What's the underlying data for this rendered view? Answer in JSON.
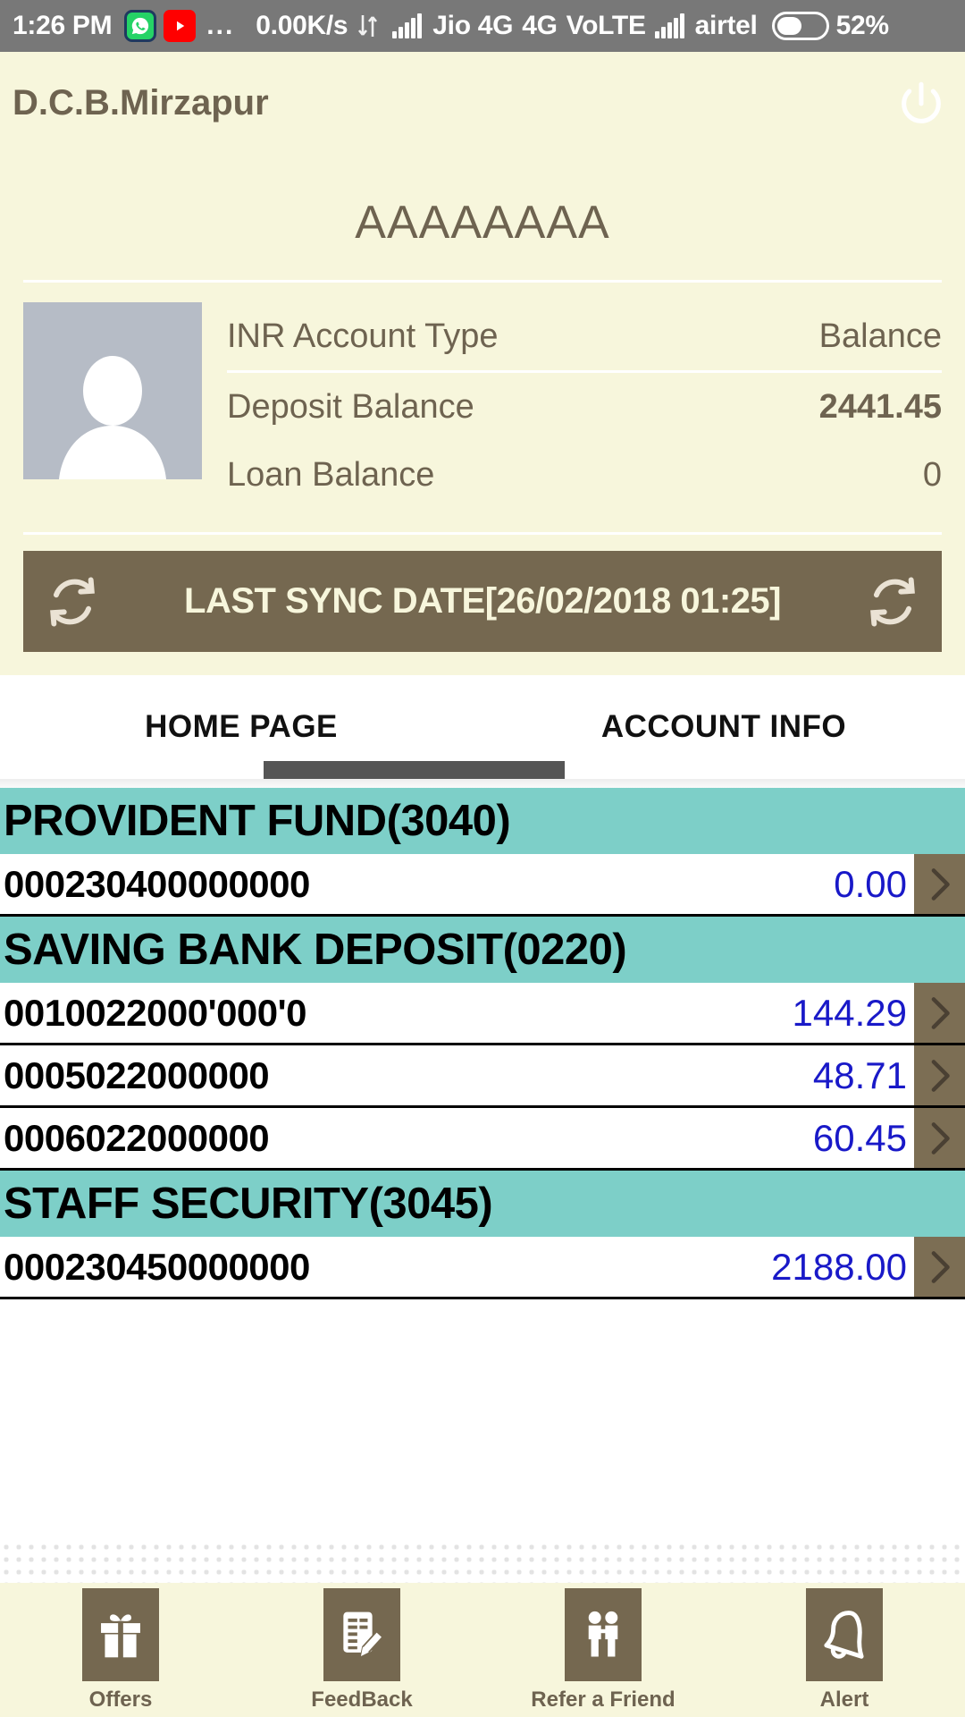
{
  "status_bar": {
    "time": "1:26 PM",
    "app_icons": [
      "whatsapp-icon",
      "youtube-icon"
    ],
    "overflow": "...",
    "data_speed": "0.00K/s",
    "sim1_label": "Jio 4G",
    "network_type": "4G",
    "volte_label": "VoLTE",
    "sim2_label": "airtel",
    "battery_percent": "52%"
  },
  "header": {
    "app_title": "D.C.B.Mirzapur",
    "power_icon": "power-icon"
  },
  "customer": {
    "name": "AAAAAAAA"
  },
  "balance_panel": {
    "avatar_icon": "user-avatar-icon",
    "rows": [
      {
        "label": "INR Account Type",
        "value": "Balance",
        "is_header": true
      },
      {
        "label": "Deposit Balance",
        "value": "2441.45",
        "is_header": false
      },
      {
        "label": "Loan Balance",
        "value": "0",
        "is_header": false
      }
    ]
  },
  "sync": {
    "text": "LAST SYNC DATE[26/02/2018 01:25]",
    "left_icon": "refresh-icon",
    "right_icon": "refresh-icon"
  },
  "tabs": {
    "items": [
      {
        "label": "HOME PAGE",
        "active": false
      },
      {
        "label": "ACCOUNT INFO",
        "active": true
      }
    ]
  },
  "account_groups": [
    {
      "title": "PROVIDENT FUND(3040)",
      "accounts": [
        {
          "number": "000230400000000",
          "balance": "0.00",
          "arrow_icon": "chevron-right-icon"
        }
      ]
    },
    {
      "title": "SAVING BANK DEPOSIT(0220)",
      "accounts": [
        {
          "number": "0010022000'000'0",
          "balance": "144.29",
          "arrow_icon": "chevron-right-icon"
        },
        {
          "number": "0005022000000",
          "balance": "48.71",
          "arrow_icon": "chevron-right-icon"
        },
        {
          "number": "0006022000000",
          "balance": "60.45",
          "arrow_icon": "chevron-right-icon"
        }
      ]
    },
    {
      "title": "STAFF SECURITY(3045)",
      "accounts": [
        {
          "number": "000230450000000",
          "balance": "2188.00",
          "arrow_icon": "chevron-right-icon"
        }
      ]
    }
  ],
  "bottom_nav": [
    {
      "label": "Offers",
      "icon": "gift-icon"
    },
    {
      "label": "FeedBack",
      "icon": "form-pencil-icon"
    },
    {
      "label": "Refer a Friend",
      "icon": "two-people-icon"
    },
    {
      "label": "Alert",
      "icon": "bell-icon"
    }
  ],
  "colors": {
    "background_cream": "#F7F6DC",
    "brown": "#756850",
    "teal_group_header": "#7DCFC8",
    "balance_blue": "#1919C8",
    "text_brown": "#6E6350",
    "status_bar_gray": "#787878",
    "tab_indicator": "#555555",
    "avatar_gray": "#B6BCC6"
  }
}
